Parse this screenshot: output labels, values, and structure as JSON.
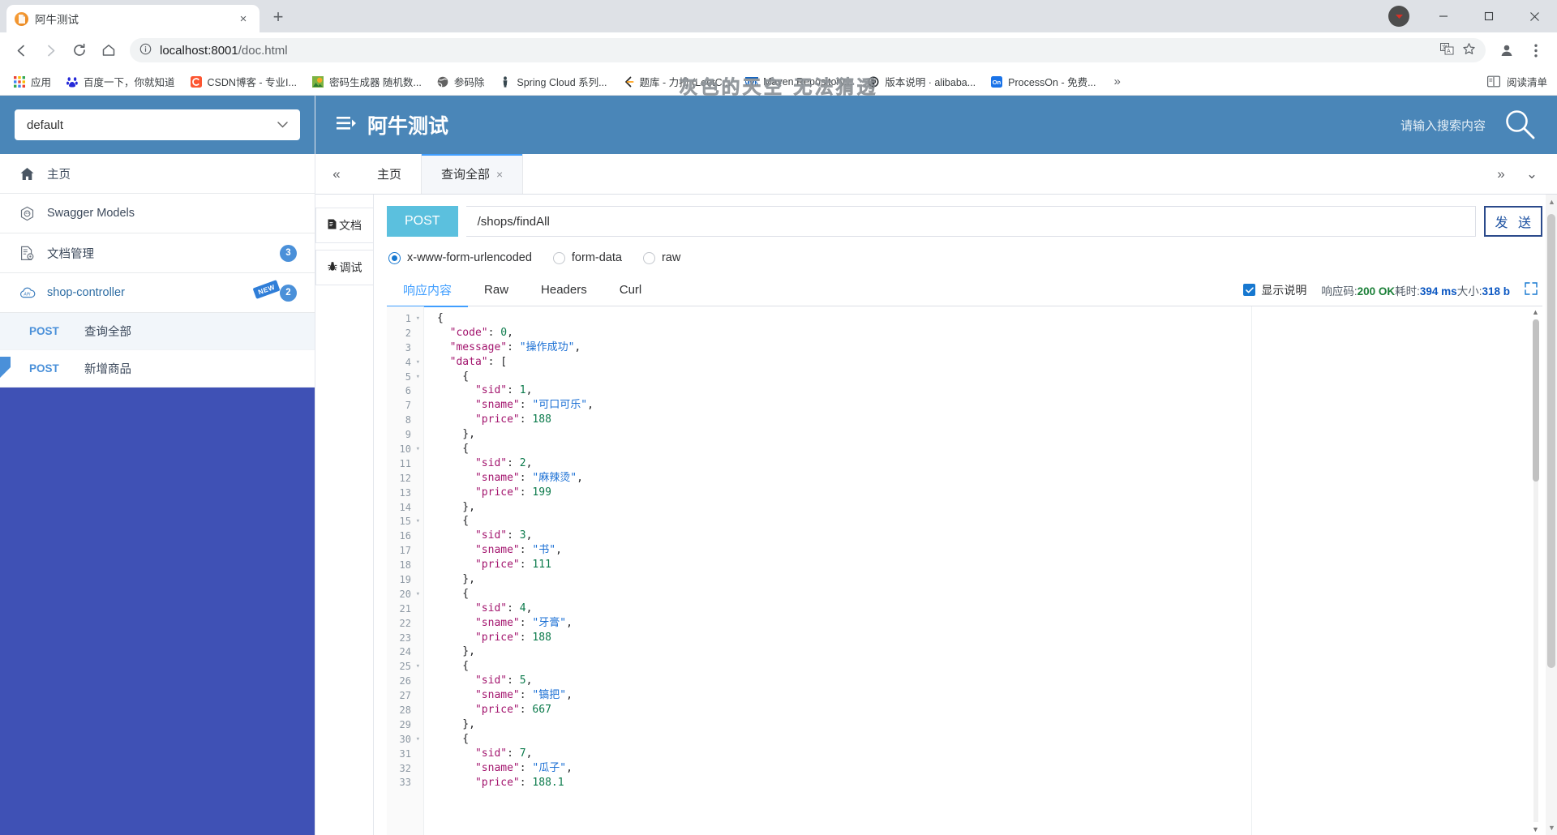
{
  "browser": {
    "tab": {
      "title": "阿牛测试",
      "favicon": "document-icon",
      "close": "×"
    },
    "new_tab": "+",
    "window": {
      "minimize": "—",
      "maximize": "▢",
      "close": "✕"
    },
    "omnibox": {
      "host": "localhost:8001",
      "path": "/doc.html",
      "info_icon": "info-icon",
      "translate_icon": "translate-icon",
      "star_icon": "star-icon",
      "profile_icon": "profile-icon",
      "menu_icon": "kebab-menu-icon"
    },
    "nav": {
      "back": "←",
      "forward": "→",
      "reload": "⟳",
      "home": "⌂"
    },
    "watermark": "灰色的天空 无法猜透",
    "bookmarks": [
      {
        "label": "应用",
        "icon": "apps-grid-icon"
      },
      {
        "label": "百度一下，你就知道",
        "icon": "baidu-icon"
      },
      {
        "label": "CSDN博客 - 专业I...",
        "icon": "csdn-icon"
      },
      {
        "label": "密码生成器 随机数...",
        "icon": "password-icon"
      },
      {
        "label": "参码除",
        "icon": "globe-icon"
      },
      {
        "label": "Spring Cloud 系列...",
        "icon": "spring-icon"
      },
      {
        "label": "题库 - 力扣 (LeetC...",
        "icon": "leetcode-icon"
      },
      {
        "label": "Maven Repository...",
        "icon": "maven-icon"
      },
      {
        "label": "版本说明 · alibaba...",
        "icon": "github-icon"
      },
      {
        "label": "ProcessOn - 免费...",
        "icon": "processon-icon"
      }
    ],
    "bookmarks_overflow": "»",
    "reading_list": {
      "label": "阅读清单",
      "icon": "reading-list-icon"
    }
  },
  "app": {
    "env_select": {
      "value": "default",
      "caret": "⌄"
    },
    "title": "阿牛测试",
    "menu_icon": "hamburger-menu-icon",
    "search": {
      "placeholder": "请输入搜索内容",
      "icon": "search-icon"
    },
    "sidebar": {
      "items": [
        {
          "label": "主页",
          "icon": "home-icon",
          "badge": ""
        },
        {
          "label": "Swagger Models",
          "icon": "cube-icon",
          "badge": ""
        },
        {
          "label": "文档管理",
          "icon": "document-gear-icon",
          "badge": "3"
        },
        {
          "label": "shop-controller",
          "icon": "api-cloud-icon",
          "badge": "2",
          "tag": "NEW"
        }
      ],
      "apis": [
        {
          "verb": "POST",
          "label": "查询全部",
          "active": true
        },
        {
          "verb": "POST",
          "label": "新增商品",
          "active": false
        }
      ]
    },
    "tabs": {
      "collapse_icon": "«",
      "items": [
        {
          "label": "主页",
          "closable": false,
          "active": false
        },
        {
          "label": "查询全部",
          "closable": true,
          "close": "×",
          "active": true
        }
      ],
      "right_icons": [
        "»",
        "⌄"
      ]
    },
    "vertical_tabs": [
      {
        "label": "文档",
        "icon": "doc-icon",
        "active": false
      },
      {
        "label": "调试",
        "icon": "bug-icon",
        "active": true
      }
    ],
    "request": {
      "method": "POST",
      "url": "/shops/findAll",
      "send_label": "发 送"
    },
    "body_types": [
      {
        "label": "x-www-form-urlencoded",
        "selected": true
      },
      {
        "label": "form-data",
        "selected": false
      },
      {
        "label": "raw",
        "selected": false
      }
    ],
    "response": {
      "tabs": [
        {
          "label": "响应内容",
          "active": true
        },
        {
          "label": "Raw",
          "active": false
        },
        {
          "label": "Headers",
          "active": false
        },
        {
          "label": "Curl",
          "active": false
        }
      ],
      "show_desc": {
        "label": "显示说明",
        "checked": true,
        "check": "✓"
      },
      "status_prefix": "响应码:",
      "status_code": "200 OK",
      "time_prefix": "耗时:",
      "time_value": "394 ms",
      "size_prefix": "大小:",
      "size_value": "318 b",
      "expand_icon": "expand-icon"
    },
    "json_lines": [
      {
        "n": 1,
        "fold": true,
        "text": "{"
      },
      {
        "n": 2,
        "fold": false,
        "text": "  \"code\": 0,"
      },
      {
        "n": 3,
        "fold": false,
        "text": "  \"message\": \"操作成功\","
      },
      {
        "n": 4,
        "fold": true,
        "text": "  \"data\": ["
      },
      {
        "n": 5,
        "fold": true,
        "text": "    {"
      },
      {
        "n": 6,
        "fold": false,
        "text": "      \"sid\": 1,"
      },
      {
        "n": 7,
        "fold": false,
        "text": "      \"sname\": \"可口可乐\","
      },
      {
        "n": 8,
        "fold": false,
        "text": "      \"price\": 188"
      },
      {
        "n": 9,
        "fold": false,
        "text": "    },"
      },
      {
        "n": 10,
        "fold": true,
        "text": "    {"
      },
      {
        "n": 11,
        "fold": false,
        "text": "      \"sid\": 2,"
      },
      {
        "n": 12,
        "fold": false,
        "text": "      \"sname\": \"麻辣烫\","
      },
      {
        "n": 13,
        "fold": false,
        "text": "      \"price\": 199"
      },
      {
        "n": 14,
        "fold": false,
        "text": "    },"
      },
      {
        "n": 15,
        "fold": true,
        "text": "    {"
      },
      {
        "n": 16,
        "fold": false,
        "text": "      \"sid\": 3,"
      },
      {
        "n": 17,
        "fold": false,
        "text": "      \"sname\": \"书\","
      },
      {
        "n": 18,
        "fold": false,
        "text": "      \"price\": 111"
      },
      {
        "n": 19,
        "fold": false,
        "text": "    },"
      },
      {
        "n": 20,
        "fold": true,
        "text": "    {"
      },
      {
        "n": 21,
        "fold": false,
        "text": "      \"sid\": 4,"
      },
      {
        "n": 22,
        "fold": false,
        "text": "      \"sname\": \"牙膏\","
      },
      {
        "n": 23,
        "fold": false,
        "text": "      \"price\": 188"
      },
      {
        "n": 24,
        "fold": false,
        "text": "    },"
      },
      {
        "n": 25,
        "fold": true,
        "text": "    {"
      },
      {
        "n": 26,
        "fold": false,
        "text": "      \"sid\": 5,"
      },
      {
        "n": 27,
        "fold": false,
        "text": "      \"sname\": \"镐把\","
      },
      {
        "n": 28,
        "fold": false,
        "text": "      \"price\": 667"
      },
      {
        "n": 29,
        "fold": false,
        "text": "    },"
      },
      {
        "n": 30,
        "fold": true,
        "text": "    {"
      },
      {
        "n": 31,
        "fold": false,
        "text": "      \"sid\": 7,"
      },
      {
        "n": 32,
        "fold": false,
        "text": "      \"sname\": \"瓜子\","
      },
      {
        "n": 33,
        "fold": false,
        "text": "      \"price\": 188.1"
      }
    ]
  },
  "colors": {
    "brand_blue": "#4a86b8",
    "accent": "#409eff",
    "verb_post": "#5bc0de",
    "sidebar_fill": "#3f51b5",
    "status_ok": "#1a7f37"
  }
}
